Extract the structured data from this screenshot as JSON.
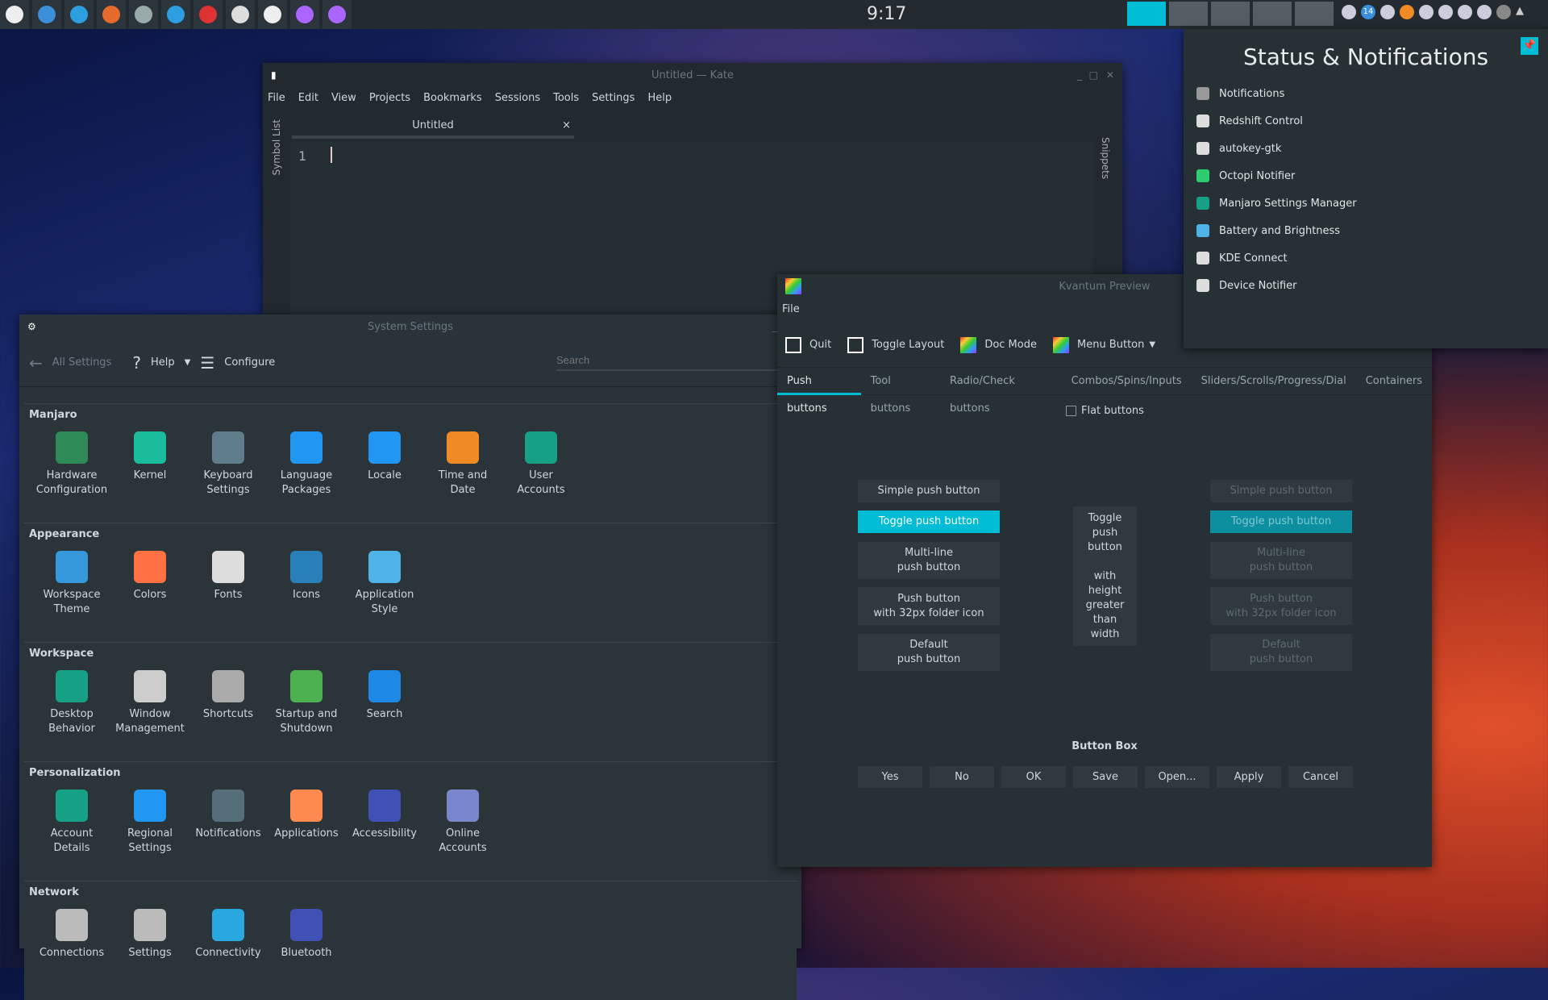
{
  "taskbar": {
    "clock": "9:17",
    "launchers": [
      "app-menu",
      "task-manager",
      "telegram",
      "firefox",
      "file-manager",
      "plasma",
      "opera",
      "system-settings",
      "kate",
      "kvantum-manager",
      "kvantum-preview"
    ],
    "tray_badge": "14"
  },
  "kate": {
    "title": "Untitled — Kate",
    "menu": [
      "File",
      "Edit",
      "View",
      "Projects",
      "Bookmarks",
      "Sessions",
      "Tools",
      "Settings",
      "Help"
    ],
    "tab": "Untitled",
    "tab_close": "×",
    "line_number": "1",
    "left_panel": "Symbol List",
    "right_panel": "Snippets"
  },
  "system_settings": {
    "title": "System Settings",
    "back": "All Settings",
    "help": "Help",
    "configure": "Configure",
    "search_placeholder": "Search",
    "categories": [
      {
        "title": "Manjaro",
        "items": [
          "Hardware\nConfiguration",
          "Kernel",
          "Keyboard\nSettings",
          "Language\nPackages",
          "Locale",
          "Time and\nDate",
          "User\nAccounts"
        ]
      },
      {
        "title": "Appearance",
        "items": [
          "Workspace\nTheme",
          "Colors",
          "Fonts",
          "Icons",
          "Application\nStyle"
        ]
      },
      {
        "title": "Workspace",
        "items": [
          "Desktop\nBehavior",
          "Window\nManagement",
          "Shortcuts",
          "Startup and\nShutdown",
          "Search"
        ]
      },
      {
        "title": "Personalization",
        "items": [
          "Account\nDetails",
          "Regional\nSettings",
          "Notifications",
          "Applications",
          "Accessibility",
          "Online\nAccounts"
        ]
      },
      {
        "title": "Network",
        "items": [
          "Connections",
          "Settings",
          "Connectivity",
          "Bluetooth"
        ]
      }
    ]
  },
  "kvantum": {
    "title": "Kvantum Preview",
    "menu_file": "File",
    "toolbar": [
      "Quit",
      "Toggle Layout",
      "Doc Mode",
      "Menu Button"
    ],
    "tabs": [
      "Push buttons",
      "Tool buttons",
      "Radio/Check buttons",
      "Combos/Spins/Inputs",
      "Sliders/Scrolls/Progress/Dial",
      "Containers"
    ],
    "flat_buttons": "Flat buttons",
    "buttons": [
      "Simple push button",
      "Toggle push button",
      "Multi-line\npush button",
      "Push button\nwith 32px folder icon",
      "Default\npush button"
    ],
    "tall_button": "Toggle\npush\nbutton\n\nwith\nheight\ngreater\nthan\nwidth",
    "button_box_label": "Button Box",
    "button_box": [
      "Yes",
      "No",
      "OK",
      "Save",
      "Open...",
      "Apply",
      "Cancel"
    ]
  },
  "notifications": {
    "title": "Status & Notifications",
    "items": [
      "Notifications",
      "Redshift Control",
      "autokey-gtk",
      "Octopi Notifier",
      "Manjaro Settings Manager",
      "Battery and Brightness",
      "KDE Connect",
      "Device Notifier"
    ]
  },
  "colors": {
    "accent": "#00bcd4",
    "window": "#2a3339",
    "panel": "#232b30"
  }
}
